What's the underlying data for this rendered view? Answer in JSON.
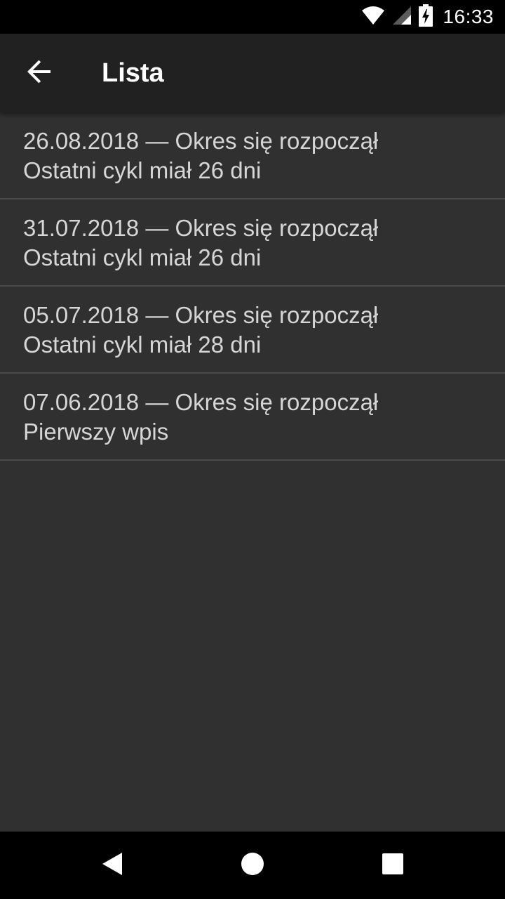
{
  "status_bar": {
    "time": "16:33",
    "icons": [
      "wifi-icon",
      "signal-icon",
      "battery-charging-icon"
    ]
  },
  "app_bar": {
    "back_icon": "arrow-left-icon",
    "title": "Lista"
  },
  "list": {
    "items": [
      {
        "line1": "26.08.2018 — Okres się rozpoczął",
        "line2": "Ostatni cykl miał 26 dni"
      },
      {
        "line1": "31.07.2018 — Okres się rozpoczął",
        "line2": "Ostatni cykl miał 26 dni"
      },
      {
        "line1": "05.07.2018 — Okres się rozpoczął",
        "line2": "Ostatni cykl miał 28 dni"
      },
      {
        "line1": "07.06.2018 — Okres się rozpoczął",
        "line2": "Pierwszy wpis"
      }
    ]
  },
  "nav_bar": {
    "icons": [
      "nav-back-icon",
      "nav-home-icon",
      "nav-recents-icon"
    ]
  },
  "colors": {
    "background": "#303030",
    "app_bar": "#212121",
    "status_bar": "#000000",
    "text": "#d6d6d6",
    "divider": "#4a4a4a"
  }
}
